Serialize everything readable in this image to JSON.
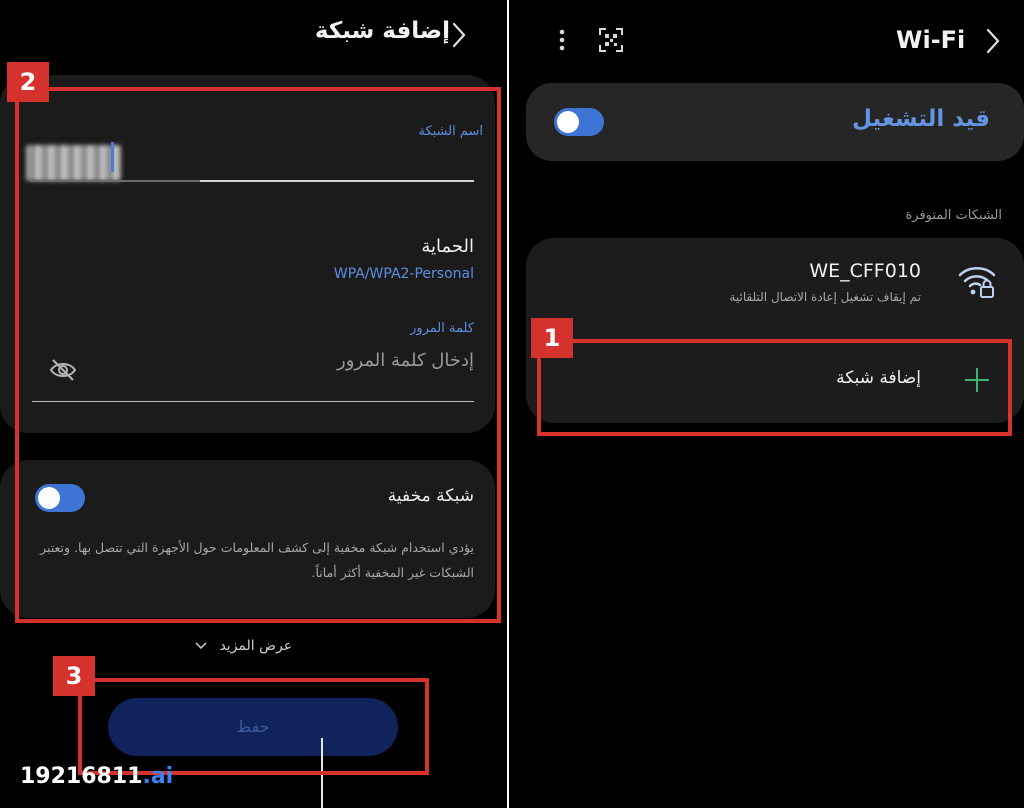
{
  "left_panel": {
    "title": "إضافة شبكة",
    "network_name_label": "اسم الشبكة",
    "security_label": "الحماية",
    "security_value": "WPA/WPA2-Personal",
    "password_label": "كلمة المرور",
    "password_placeholder": "إدخال كلمة المرور",
    "hidden_network_label": "شبكة مخفية",
    "hidden_network_desc": "يؤدي استخدام شبكة مخفية إلى كشف المعلومات حول الأجهزة التي تتصل بها. وتعتبر الشبكات غير المخفية أكثر أماناً.",
    "show_more": "عرض المزيد",
    "save_button": "حفظ"
  },
  "right_panel": {
    "title": "Wi-Fi",
    "toggle_label": "قيد التشغيل",
    "available_networks_label": "الشبكات المتوفرة",
    "network": {
      "ssid": "WE_CFF010",
      "subtitle": "تم إيقاف تشغيل إعادة الاتصال التلقائية"
    },
    "add_network_label": "إضافة شبكة"
  },
  "annotations": {
    "step1": "1",
    "step2": "2",
    "step3": "3"
  },
  "watermark": {
    "main": "19216811",
    "accent": ".ai"
  },
  "colors": {
    "accent_blue": "#5d8fe0",
    "toggle_blue": "#3d74d6",
    "annotation_red": "#d5322d",
    "plus_green": "#3cb371"
  },
  "icons": [
    "back-chevron-icon",
    "eye-off-icon",
    "kebab-menu-icon",
    "qr-code-icon",
    "wifi-lock-icon",
    "plus-icon"
  ]
}
